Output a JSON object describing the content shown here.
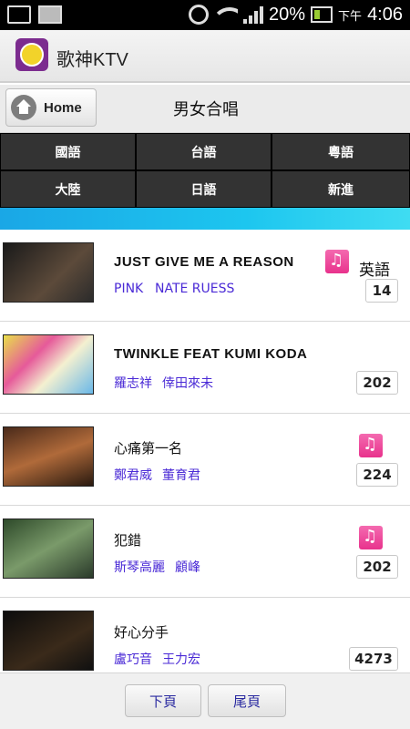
{
  "status_bar": {
    "battery": "20%",
    "ampm": "下午",
    "time": "4:06"
  },
  "app": {
    "title": "歌神KTV"
  },
  "subheader": {
    "home_label": "Home",
    "heading": "男女合唱"
  },
  "categories": [
    "國語",
    "台語",
    "粵語",
    "大陸",
    "日語",
    "新進"
  ],
  "songs": [
    {
      "title": "JUST GIVE ME A REASON",
      "singers": [
        "PINK",
        "NATE RUESS"
      ],
      "lang": "英語",
      "number": "14",
      "has_note": true
    },
    {
      "title": "TWINKLE FEAT KUMI KODA",
      "singers": [
        "羅志祥",
        "倖田來未"
      ],
      "lang": "",
      "number": "202",
      "has_note": false
    },
    {
      "title": "心痛第一名",
      "singers": [
        "鄭君威",
        "董育君"
      ],
      "lang": "",
      "number": "224",
      "has_note": true
    },
    {
      "title": "犯錯",
      "singers": [
        "斯琴高麗",
        "顧峰"
      ],
      "lang": "",
      "number": "202",
      "has_note": true
    },
    {
      "title": "好心分手",
      "singers": [
        "盧巧音",
        "王力宏"
      ],
      "lang": "",
      "number": "4273",
      "has_note": false
    }
  ],
  "pager": {
    "next_label": "下頁",
    "last_label": "尾頁"
  },
  "colors": {
    "singer_link": "#4a2ad6",
    "grid_bg": "#333333",
    "stripe": "#1dc6ef",
    "note_icon": "#e8328c"
  }
}
